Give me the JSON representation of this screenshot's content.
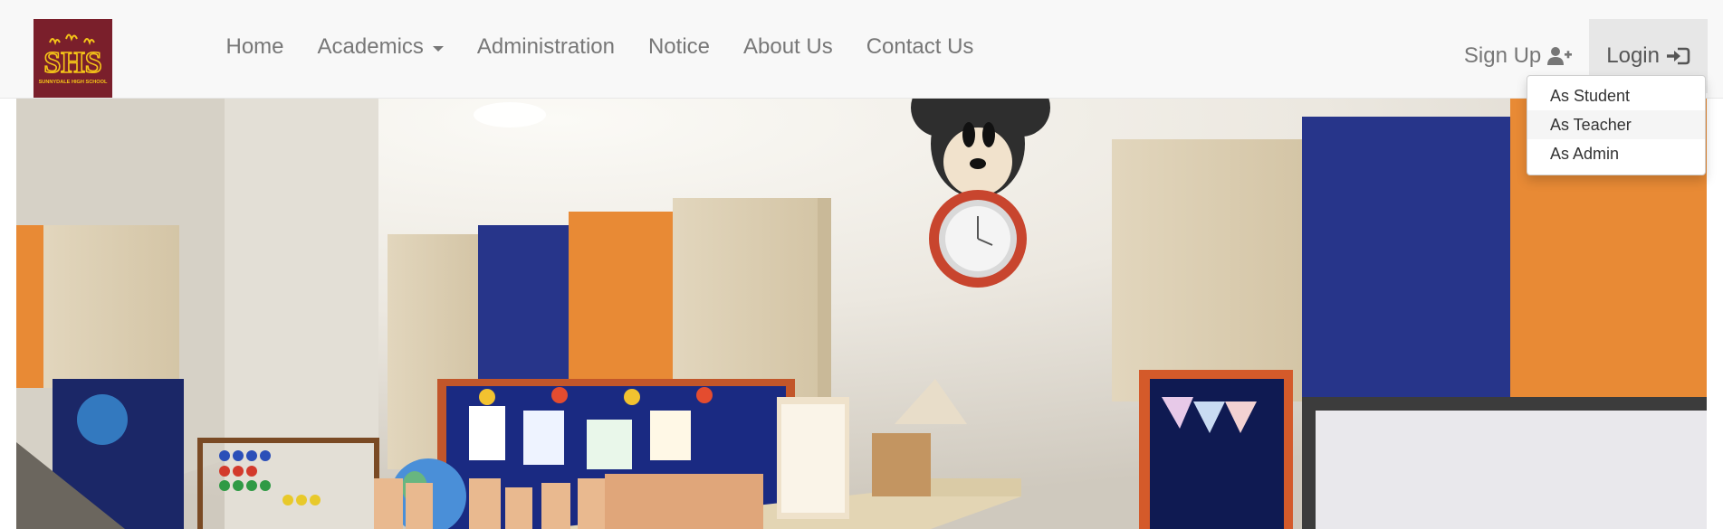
{
  "brand": {
    "logo_text": "SHS",
    "logo_subtext": "SUNNYDALE HIGH SCHOOL"
  },
  "nav": {
    "items": [
      {
        "label": "Home"
      },
      {
        "label": "Academics"
      },
      {
        "label": "Administration"
      },
      {
        "label": "Notice"
      },
      {
        "label": "About Us"
      },
      {
        "label": "Contact Us"
      }
    ],
    "signup_label": "Sign Up",
    "signup_icon": "user-plus-icon",
    "login_label": "Login",
    "login_icon": "sign-in-icon"
  },
  "login_dropdown": {
    "items": [
      {
        "label": "As Student"
      },
      {
        "label": "As Teacher"
      },
      {
        "label": "As Admin"
      }
    ]
  },
  "hero": {
    "description": "classroom-photo"
  },
  "colors": {
    "logo_bg": "#7a1f2b",
    "logo_fg": "#f5c518",
    "nav_text": "#777777",
    "active_bg": "#e7e7e7"
  }
}
